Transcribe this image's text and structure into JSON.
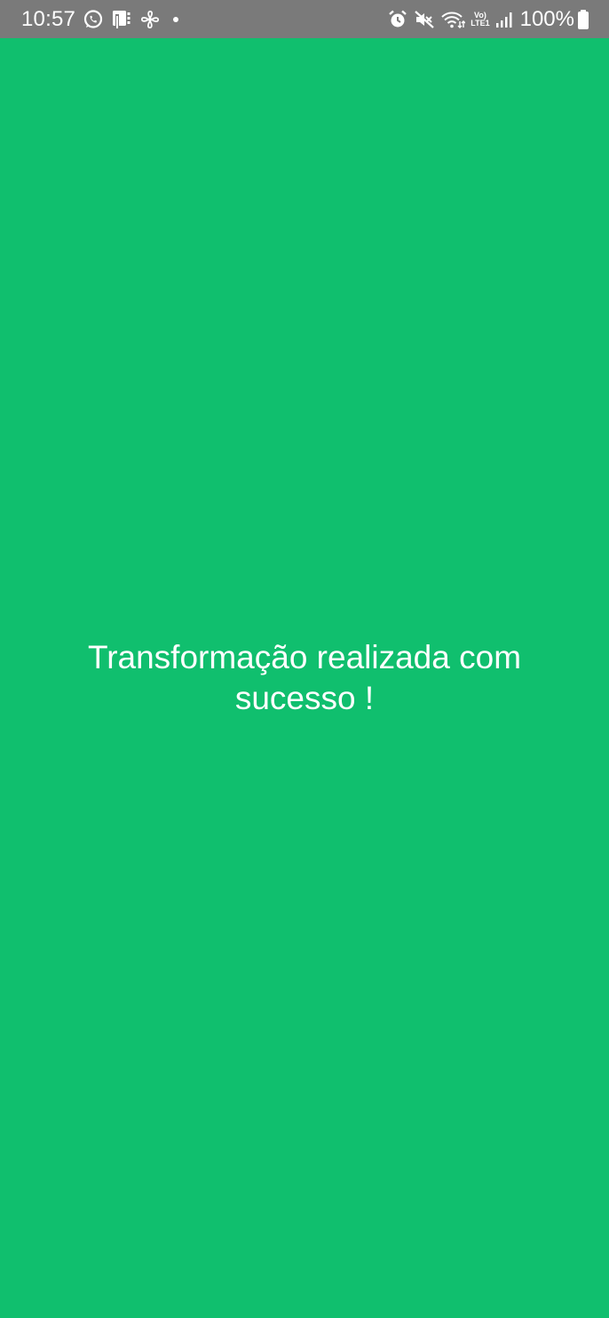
{
  "status_bar": {
    "time": "10:57",
    "left_icons": [
      "whatsapp-icon",
      "sim-card-icon",
      "fan-icon",
      "notification-dot"
    ],
    "right_icons": [
      "alarm-icon",
      "mute-icon",
      "wifi-icon",
      "volte-icon",
      "signal-icon",
      "battery-icon"
    ],
    "volte_top": "Vo)",
    "volte_bottom": "LTE1",
    "battery_percent": "100%",
    "background": "#7a7a7a"
  },
  "main": {
    "background": "#10BF6E",
    "message_line1": "Transformação realizada com",
    "message_line2": "sucesso !"
  }
}
